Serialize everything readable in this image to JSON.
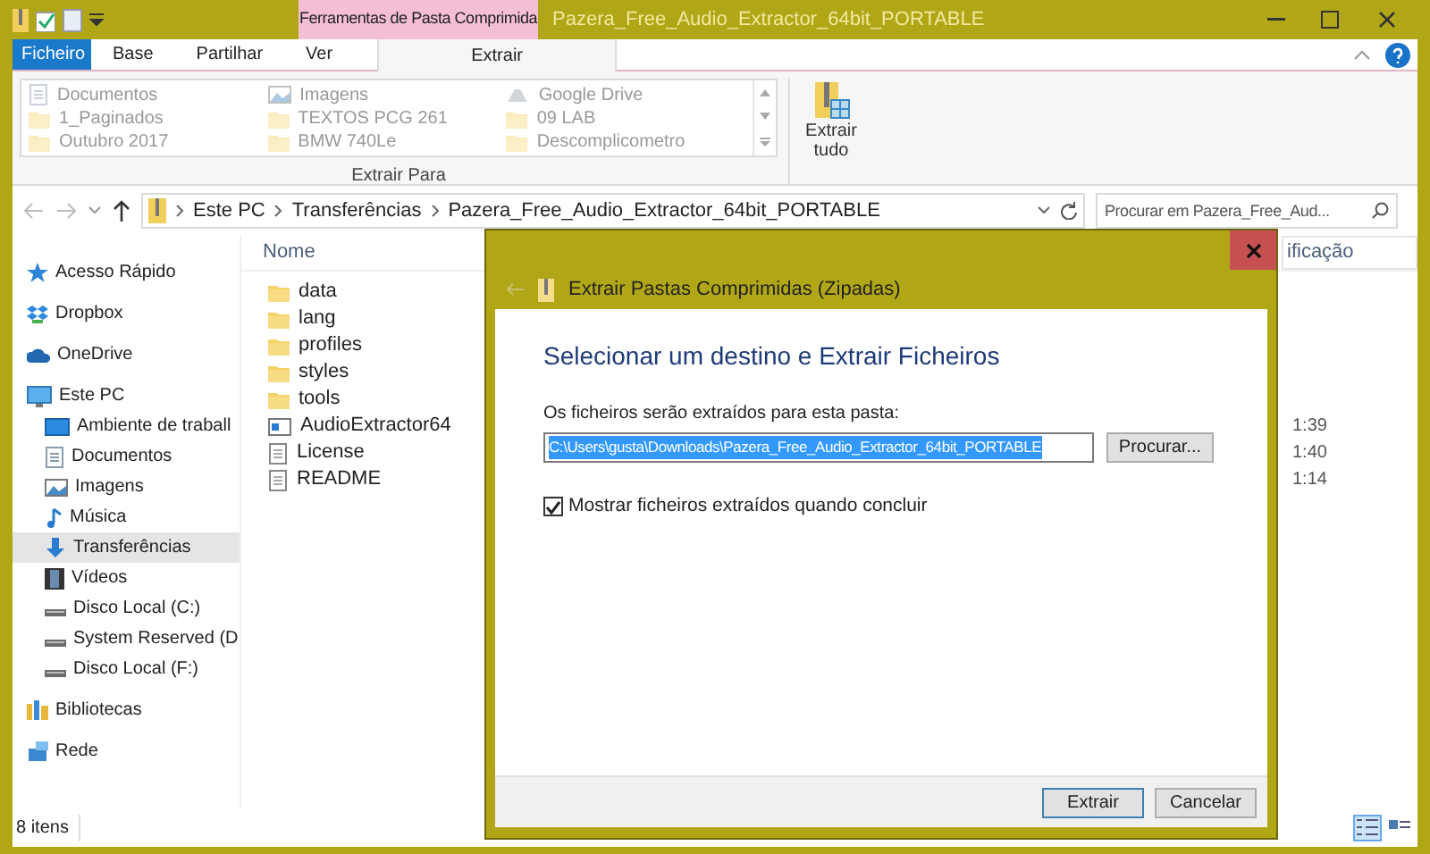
{
  "window": {
    "title": "Pazera_Free_Audio_Extractor_64bit_PORTABLE"
  },
  "ribbon": {
    "contextual_group": "Ferramentas de Pasta Comprimida",
    "tabs": [
      {
        "label": "Ficheiro",
        "kind": "file",
        "selected": false
      },
      {
        "label": "Base",
        "kind": "tab",
        "selected": false
      },
      {
        "label": "Partilhar",
        "kind": "tab",
        "selected": false
      },
      {
        "label": "Ver",
        "kind": "tab",
        "selected": false
      },
      {
        "label": "Extrair",
        "kind": "contextual",
        "selected": true
      }
    ],
    "destinations": [
      {
        "label": "Documentos",
        "kind": "doc"
      },
      {
        "label": "1_Paginados",
        "kind": "folder"
      },
      {
        "label": "Outubro 2017",
        "kind": "folder"
      },
      {
        "label": "Imagens",
        "kind": "image"
      },
      {
        "label": "TEXTOS PCG 261",
        "kind": "folder"
      },
      {
        "label": "BMW 740Le",
        "kind": "folder"
      },
      {
        "label": "Google Drive",
        "kind": "drive"
      },
      {
        "label": "09 LAB",
        "kind": "folder"
      },
      {
        "label": "Descomplicometro",
        "kind": "folder"
      }
    ],
    "group_label": "Extrair Para",
    "extract_all": "Extrair tudo"
  },
  "address": {
    "breadcrumbs": [
      "Este PC",
      "Transferências",
      "Pazera_Free_Audio_Extractor_64bit_PORTABLE"
    ],
    "search_placeholder": "Procurar em Pazera_Free_Aud..."
  },
  "nav": [
    {
      "label": "Acesso Rápido",
      "kind": "star",
      "selected": false
    },
    {
      "label": "Dropbox",
      "kind": "dropbox",
      "selected": false
    },
    {
      "label": "OneDrive",
      "kind": "cloud",
      "selected": false
    },
    {
      "label": "Este PC",
      "kind": "pc",
      "selected": false,
      "children": [
        {
          "label": "Ambiente de traball",
          "kind": "desktop",
          "selected": false
        },
        {
          "label": "Documentos",
          "kind": "doc",
          "selected": false
        },
        {
          "label": "Imagens",
          "kind": "image",
          "selected": false
        },
        {
          "label": "Música",
          "kind": "music",
          "selected": false
        },
        {
          "label": "Transferências",
          "kind": "download",
          "selected": true
        },
        {
          "label": "Vídeos",
          "kind": "video",
          "selected": false
        },
        {
          "label": "Disco Local (C:)",
          "kind": "disk",
          "selected": false
        },
        {
          "label": "System Reserved (D",
          "kind": "disk",
          "selected": false
        },
        {
          "label": "Disco Local (F:)",
          "kind": "disk",
          "selected": false
        }
      ]
    },
    {
      "label": "Bibliotecas",
      "kind": "library",
      "selected": false
    },
    {
      "label": "Rede",
      "kind": "network",
      "selected": false
    }
  ],
  "files": {
    "columns": [
      "Nome",
      "ificação"
    ],
    "rows": [
      {
        "name": "data",
        "kind": "folder"
      },
      {
        "name": "lang",
        "kind": "folder"
      },
      {
        "name": "profiles",
        "kind": "folder"
      },
      {
        "name": "styles",
        "kind": "folder"
      },
      {
        "name": "tools",
        "kind": "folder"
      },
      {
        "name": "AudioExtractor64",
        "kind": "app",
        "column_2": "1:39"
      },
      {
        "name": "License",
        "kind": "text",
        "column_2": "1:40"
      },
      {
        "name": "README",
        "kind": "text",
        "column_2": "1:14"
      }
    ]
  },
  "status_bar": {
    "count": "8 itens",
    "views": [
      {
        "kind": "details",
        "selected": true
      },
      {
        "kind": "tiles",
        "selected": false
      }
    ]
  },
  "dialog": {
    "title": "Extrair Pastas Comprimidas (Zipadas)",
    "heading": "Selecionar um destino e Extrair Ficheiros",
    "path_label": "Os ficheiros serão extraídos para esta pasta:",
    "path": "C:\\Users\\gusta\\Downloads\\Pazera_Free_Audio_Extractor_64bit_PORTABLE",
    "browse": "Procurar...",
    "show_files": {
      "label": "Mostrar ficheiros extraídos quando concluir",
      "checked": true
    },
    "buttons": [
      "Extrair",
      "Cancelar"
    ]
  }
}
